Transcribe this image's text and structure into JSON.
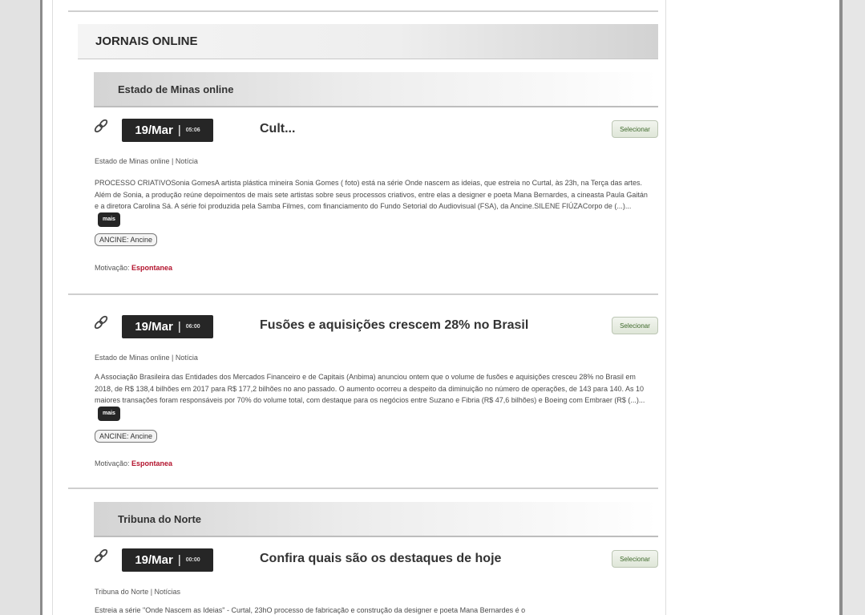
{
  "section": {
    "title": "JORNAIS ONLINE"
  },
  "sources": [
    {
      "name": "Estado de Minas online",
      "articles": [
        {
          "date": "19/Mar",
          "separator": "|",
          "time": "05:06",
          "title": "Cult...",
          "select_label": "Selecionar",
          "meta": "Estado de Minas online | Notícia",
          "body": "PROCESSO CRIATIVOSonia GomesA artista plástica mineira Sonia Gomes ( foto) está na série Onde nascem as ideias, que estreia no Curtal, às 23h, na Terça das artes. Além de Sonia, a produção reúne depoimentos de mais sete artistas sobre seus processos criativos, entre elas a designer e poeta Mana Bernardes, a cineasta Paula Gaitán e a diretora Carolina Sá. A série foi produzida pela Samba Filmes, com financiamento do Fundo Setorial do Audiovisual (FSA), da Ancine.SILENE FIÚZACorpo de (...)...",
          "more_label": "mais",
          "tag": "ANCINE: Ancine",
          "motivation_label": "Motivação:",
          "motivation_value": "Espontanea"
        },
        {
          "date": "19/Mar",
          "separator": "|",
          "time": "06:00",
          "title": "Fusões e aquisições crescem 28% no Brasil",
          "select_label": "Selecionar",
          "meta": "Estado de Minas online | Notícia",
          "body": "A Associação Brasileira das Entidades dos Mercados Financeiro e de Capitais (Anbima) anunciou ontem que o volume de fusões e aquisições cresceu 28% no Brasil em 2018, de R$ 138,4 bilhões em 2017 para R$ 177,2 bilhões no ano passado. O aumento ocorreu a despeito da diminuição no número de operações, de 143 para 140. As 10 maiores transações foram responsáveis por 70% do volume total, com destaque para os negócios entre Suzano e Fibria (R$ 47,6 bilhões) e Boeing com Embraer (R$ (...)...",
          "more_label": "mais",
          "tag": "ANCINE: Ancine",
          "motivation_label": "Motivação:",
          "motivation_value": "Espontanea"
        }
      ]
    },
    {
      "name": "Tribuna do Norte",
      "articles": [
        {
          "date": "19/Mar",
          "separator": "|",
          "time": "00:00",
          "title": "Confira quais são os destaques de hoje",
          "select_label": "Selecionar",
          "meta": "Tribuna do Norte | Notícias",
          "body": "Estreia a série \"Onde Nascem as Ideias\" - Curtal, 23hO processo de fabricação e construção da designer e poeta Mana Bernardes é o"
        }
      ]
    }
  ]
}
